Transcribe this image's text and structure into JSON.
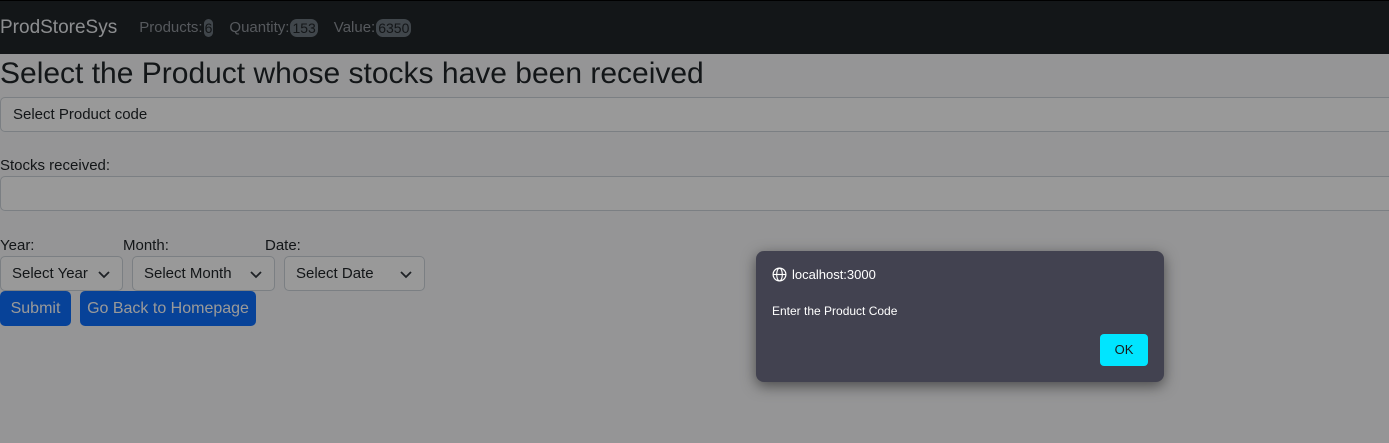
{
  "navbar": {
    "brand": "ProdStoreSys",
    "products_label": "Products:",
    "products_value": "6",
    "quantity_label": "Quantity:",
    "quantity_value": "153",
    "value_label": "Value:",
    "value_value": "6350"
  },
  "page": {
    "title": "Select the Product whose stocks have been received",
    "product_select": "Select Product code",
    "stocks_label": "Stocks received:",
    "stocks_value": "",
    "year_label": "Year:",
    "month_label": "Month:",
    "date_label": "Date:",
    "year_select": "Select Year",
    "month_select": "Select Month",
    "date_select": "Select Date",
    "submit_label": "Submit",
    "back_label": "Go Back to Homepage"
  },
  "dialog": {
    "origin": "localhost:3000",
    "message": "Enter the Product Code",
    "ok_label": "OK",
    "icon": "globe-icon"
  },
  "colors": {
    "navbar_bg": "#212529",
    "primary": "#0d6efd",
    "dialog_bg": "#424250",
    "dialog_ok": "#00e5ff"
  }
}
